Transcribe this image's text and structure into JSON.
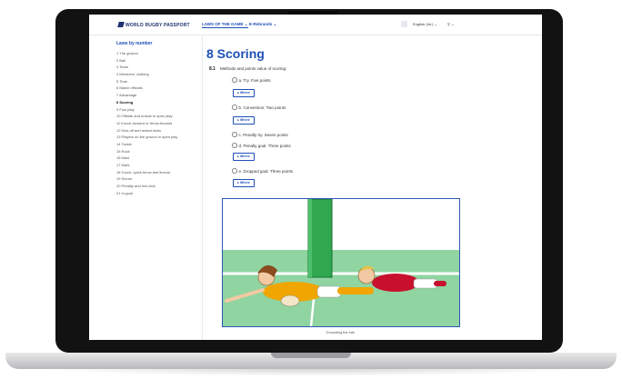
{
  "topbar": {
    "brand": "WORLD RUGBY PASSPORT",
    "nav_laws": "LAWS OF THE GAME ⌄",
    "nav_more": "E-Rebrands ⌄",
    "language": "English (Int.) ⌄",
    "user": "⚲ ⌄"
  },
  "sidebar": {
    "title": "Laws by number",
    "items": [
      "1 The ground",
      "2 Ball",
      "3 Team",
      "4 Members' clothing",
      "5 Time",
      "6 Match officials",
      "7 Advantage",
      "8 Scoring",
      "9 Foul play",
      "10 Offside and onside in open play",
      "11 Knock-forward or throw-forward",
      "12 Kick-off and restart kicks",
      "13 Players on the ground in open play",
      "14 Tackle",
      "15 Ruck",
      "16 Maul",
      "17 Mark",
      "18 Touch, quick throw and lineout",
      "19 Scrum",
      "20 Penalty and free-kick",
      "21 In-goal"
    ],
    "active_index": 7
  },
  "main": {
    "title": "8 Scoring",
    "question_number": "8.1",
    "question_text": "Methods and points value of scoring:",
    "options": [
      "a. Try. Five points",
      "b. Conversion. Two points",
      "c. Penalty try. Seven points",
      "d. Penalty goal. Three points",
      "e. Dropped goal. Three points"
    ],
    "where_label": "▸ Where",
    "caption": "Grounding the ball"
  },
  "colors": {
    "accent": "#1d4fb8",
    "post": "#2fa84f",
    "grass": "#8fd4a1"
  }
}
